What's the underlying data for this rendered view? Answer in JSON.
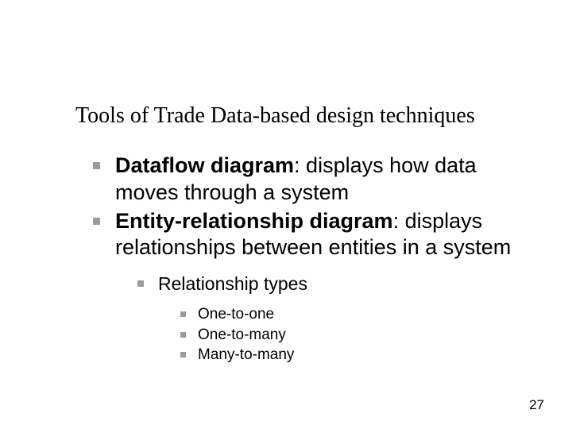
{
  "title": "Tools of Trade Data-based design techniques",
  "b1": {
    "term": "Dataflow diagram",
    "desc": ": displays how data moves through a system"
  },
  "b2": {
    "term": "Entity-relationship diagram",
    "desc": ": displays relationships between entities in a system"
  },
  "sub1": "Relationship types",
  "t1": "One-to-one",
  "t2": "One-to-many",
  "t3": "Many-to-many",
  "page": "27"
}
